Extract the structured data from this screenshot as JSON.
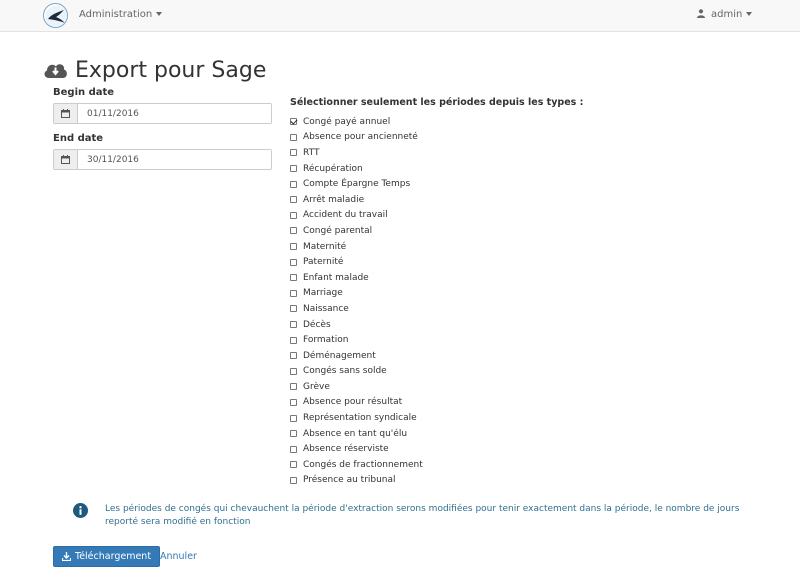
{
  "navbar": {
    "menu_label": "Administration",
    "user_label": "admin"
  },
  "page": {
    "title": "Export pour Sage"
  },
  "form": {
    "begin_label": "Begin date",
    "begin_value": "01/11/2016",
    "end_label": "End date",
    "end_value": "30/11/2016"
  },
  "types": {
    "title": "Sélectionner seulement les périodes depuis les types :",
    "items": [
      {
        "label": "Congé payé annuel",
        "checked": true
      },
      {
        "label": "Absence pour ancienneté",
        "checked": false
      },
      {
        "label": "RTT",
        "checked": false
      },
      {
        "label": "Récupération",
        "checked": false
      },
      {
        "label": "Compte Épargne Temps",
        "checked": false
      },
      {
        "label": "Arrêt maladie",
        "checked": false
      },
      {
        "label": "Accident du travail",
        "checked": false
      },
      {
        "label": "Congé parental",
        "checked": false
      },
      {
        "label": "Maternité",
        "checked": false
      },
      {
        "label": "Paternité",
        "checked": false
      },
      {
        "label": "Enfant malade",
        "checked": false
      },
      {
        "label": "Marriage",
        "checked": false
      },
      {
        "label": "Naissance",
        "checked": false
      },
      {
        "label": "Décès",
        "checked": false
      },
      {
        "label": "Formation",
        "checked": false
      },
      {
        "label": "Déménagement",
        "checked": false
      },
      {
        "label": "Congés sans solde",
        "checked": false
      },
      {
        "label": "Grève",
        "checked": false
      },
      {
        "label": "Absence pour résultat",
        "checked": false
      },
      {
        "label": "Représentation syndicale",
        "checked": false
      },
      {
        "label": "Absence en tant qu'élu",
        "checked": false
      },
      {
        "label": "Absence réserviste",
        "checked": false
      },
      {
        "label": "Congés de fractionnement",
        "checked": false
      },
      {
        "label": "Présence au tribunal",
        "checked": false
      }
    ]
  },
  "info": {
    "text": "Les périodes de congés qui chevauchent la période d'extraction serons modifiées pour tenir exactement dans la période, le nombre de jours reporté sera modifié en fonction"
  },
  "actions": {
    "download_label": "Téléchargement",
    "cancel_label": "Annuler"
  },
  "colors": {
    "primary": "#337ab7",
    "info_text": "#31708f"
  }
}
